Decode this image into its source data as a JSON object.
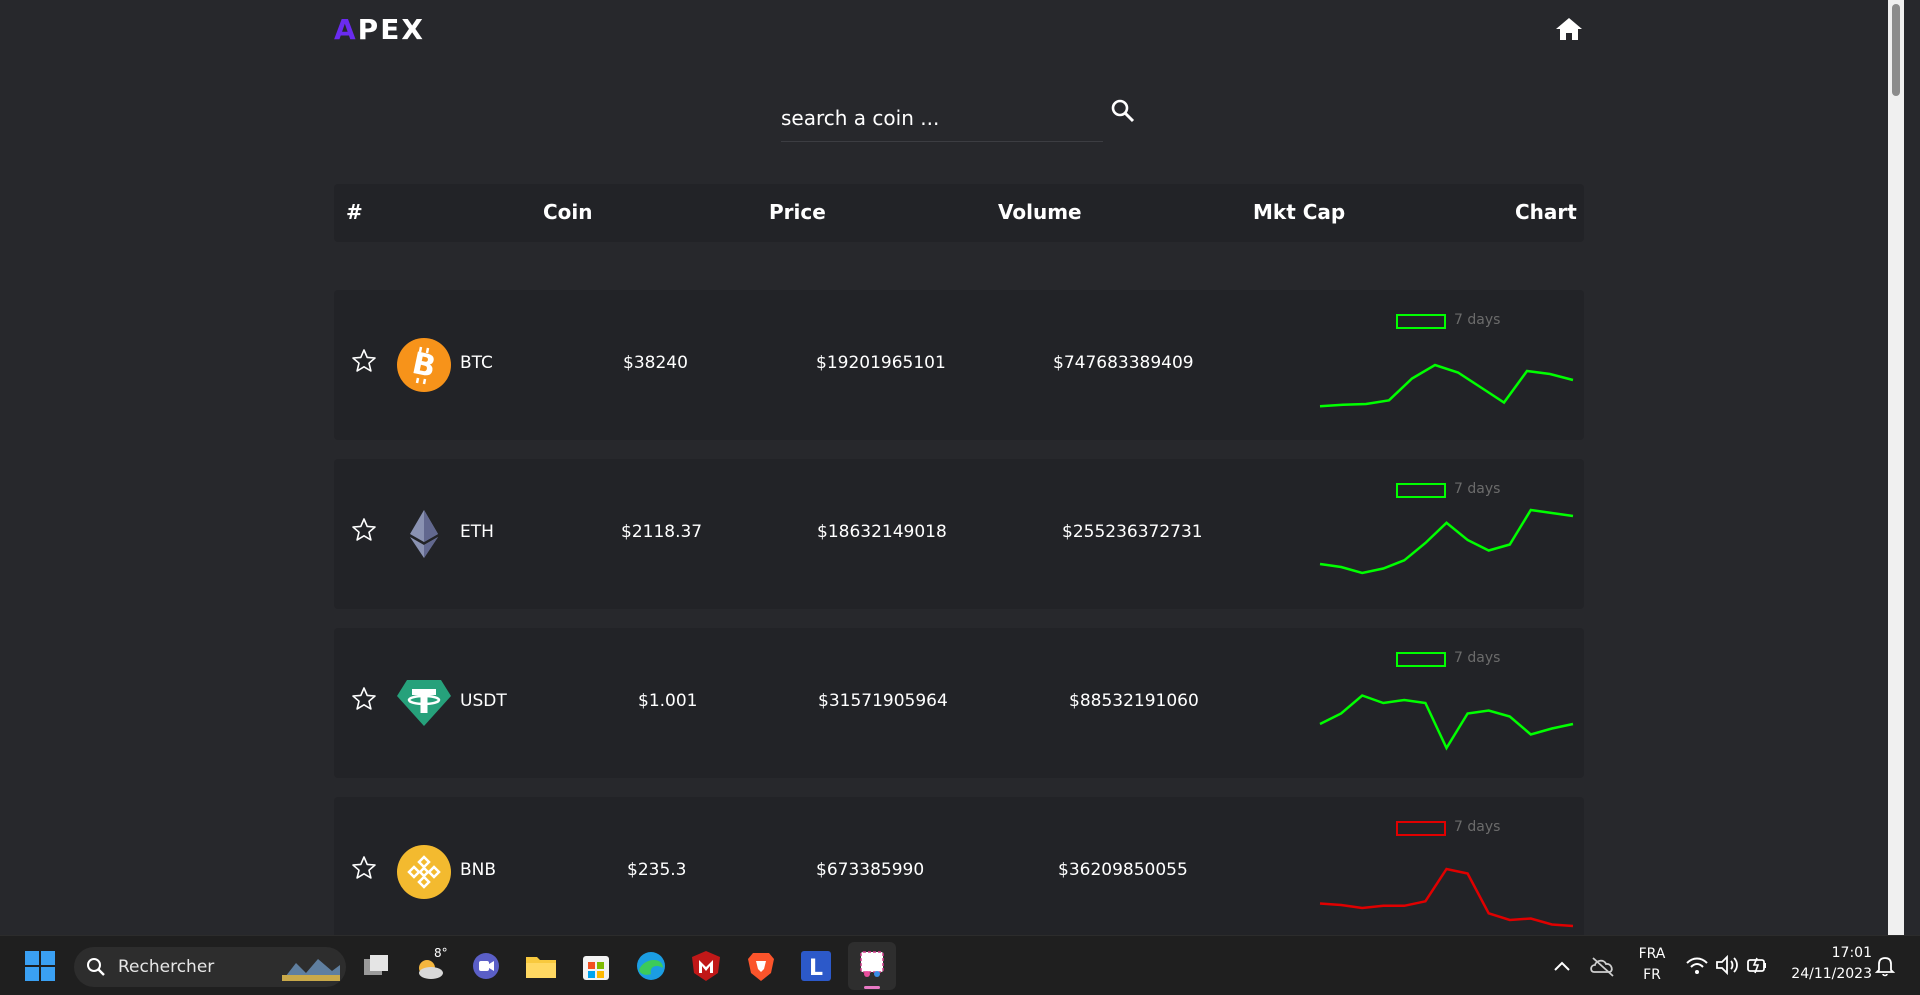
{
  "header": {
    "logo_accent": "A",
    "logo_rest": "PEX",
    "home_icon": "home-icon"
  },
  "search": {
    "placeholder": "search a coin ...",
    "icon": "search-icon"
  },
  "table": {
    "columns": [
      "#",
      "Coin",
      "Price",
      "Volume",
      "Mkt Cap",
      "Chart"
    ],
    "legend_label": "7 days",
    "rows": [
      {
        "symbol": "BTC",
        "price": "$38240",
        "volume": "$19201965101",
        "mkt_cap": "$747683389409",
        "trend": "up",
        "color": "#00ff00",
        "spark": [
          25,
          27,
          28,
          33,
          62,
          80,
          70,
          50,
          30,
          72,
          68,
          60
        ]
      },
      {
        "symbol": "ETH",
        "price": "$2118.37",
        "volume": "$18632149018",
        "mkt_cap": "$255236372731",
        "trend": "up",
        "color": "#00ff00",
        "spark": [
          40,
          36,
          28,
          34,
          45,
          68,
          95,
          72,
          58,
          66,
          112,
          108,
          104
        ]
      },
      {
        "symbol": "USDT",
        "price": "$1.001",
        "volume": "$31571905964",
        "mkt_cap": "$88532191060",
        "trend": "up",
        "color": "#00ff00",
        "spark": [
          52,
          66,
          90,
          80,
          84,
          80,
          20,
          66,
          70,
          62,
          38,
          46,
          52
        ]
      },
      {
        "symbol": "BNB",
        "price": "$235.3",
        "volume": "$673385990",
        "mkt_cap": "$36209850055",
        "trend": "down",
        "color": "#e00000",
        "spark": [
          38,
          36,
          32,
          35,
          35,
          41,
          84,
          78,
          25,
          16,
          18,
          10,
          8
        ]
      }
    ]
  },
  "taskbar": {
    "search_text": "Rechercher",
    "weather_temp": "8°",
    "lang_1": "FRA",
    "lang_2": "FR",
    "time": "17:01",
    "date": "24/11/2023"
  }
}
